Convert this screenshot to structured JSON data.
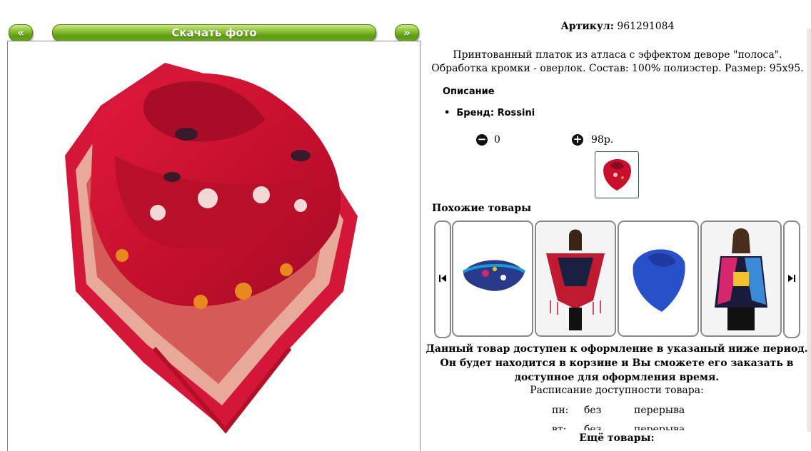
{
  "nav": {
    "prev_label": "«",
    "download_label": "Скачать фото",
    "next_label": "»"
  },
  "product": {
    "article_label": "Артикул:",
    "article_value": "961291084",
    "description": "Принтованный платок из атласа с эффектом деворе \"полоса\". Обработка кромки - оверлок. Состав: 100% полиэстер. Размер: 95х95.",
    "description_heading": "Описание",
    "brand": "Бренд: Rossini",
    "minus_value": "0",
    "plus_value": "98р."
  },
  "similar": {
    "heading": "Похожие товары"
  },
  "availability": {
    "notice": "Данный товар доступен к оформление в указаный ниже период. Он будет находится в корзине и Вы сможете его заказать в доступное для оформления время.",
    "schedule_heading": "Расписание доступности товара:",
    "rows": [
      {
        "day": "пн:",
        "from": "без",
        "to": "перерыва"
      },
      {
        "day": "вт:",
        "from": "без",
        "to": "перерыва"
      }
    ]
  },
  "more": {
    "heading": "Ещё товары:"
  },
  "colors": {
    "accent_green": "#6ba41d",
    "scarf_red": "#c8102e"
  }
}
